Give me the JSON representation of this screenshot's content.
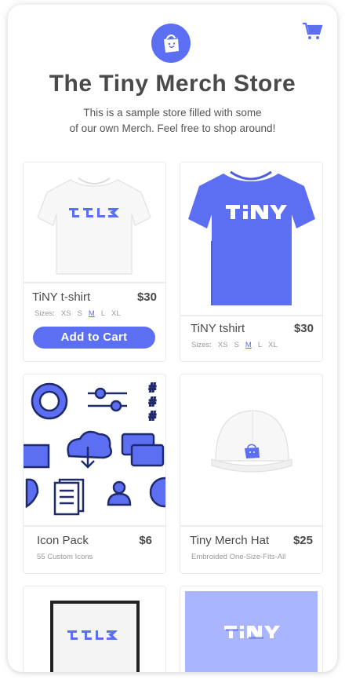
{
  "header": {
    "title": "The Tiny Merch Store",
    "subtitle_line1": "This is a sample store filled with some",
    "subtitle_line2": "of our own Merch. Feel free to shop around!"
  },
  "colors": {
    "accent": "#5c6ff2",
    "text": "#4a4a4a",
    "muted": "#999999",
    "light_accent": "#aab5ff"
  },
  "icons": {
    "logo": "shopping-bag-icon",
    "cart": "cart-icon"
  },
  "sizes_label": "Sizes:",
  "products": [
    {
      "name": "TiNY t-shirt",
      "price": "$30",
      "sizes": [
        "XS",
        "S",
        "M",
        "L",
        "XL"
      ],
      "selected_size": "M",
      "button": "Add to Cart",
      "image": "white t-shirt with tiny logo"
    },
    {
      "name": "TiNY tshirt",
      "price": "$30",
      "sizes": [
        "XS",
        "S",
        "M",
        "L",
        "XL"
      ],
      "selected_size": "M",
      "image": "blue t-shirt with tiny logo"
    },
    {
      "name": "Icon Pack",
      "price": "$6",
      "desc": "55 Custom Icons",
      "image": "icon collage"
    },
    {
      "name": "Tiny Merch Hat",
      "price": "$25",
      "desc": "Embroided One-Size-Fits-All",
      "image": "white cap"
    },
    {
      "image": "framed tiny logo print"
    },
    {
      "image": "tiny logo on blue background"
    }
  ]
}
